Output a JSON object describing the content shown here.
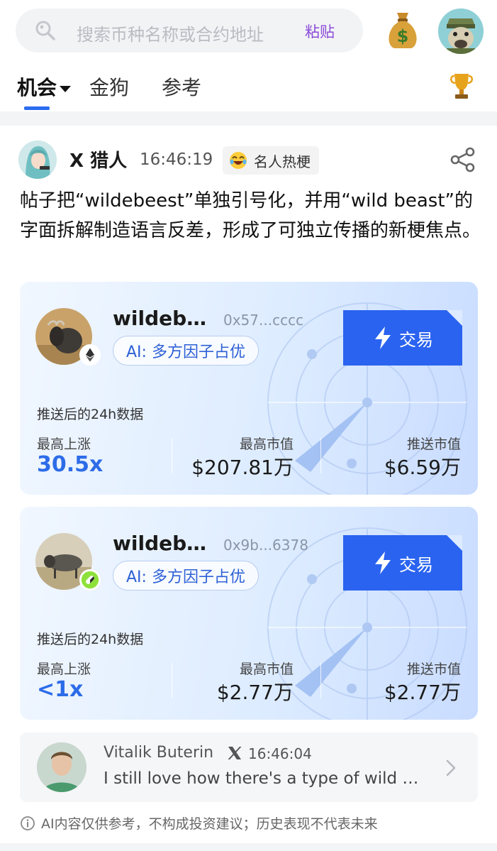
{
  "search": {
    "placeholder": "搜索币种名称或合约地址",
    "paste_label": "粘贴"
  },
  "tabs": [
    {
      "label": "机会"
    },
    {
      "label": "金狗"
    },
    {
      "label": "参考"
    }
  ],
  "post": {
    "author": "X 猎人",
    "time": "16:46:19",
    "tag": "名人热梗",
    "body": "帖子把“wildebeest”单独引号化，并用“wild beast”的字面拆解制造语言反差，形成了可独立传播的新梗焦点。"
  },
  "cards": [
    {
      "token_name": "wildeb…",
      "address": "0x57...cccc",
      "ai_label": "AI: 多方因子占优",
      "trade_label": "交易",
      "data_caption": "推送后的24h数据",
      "gain_label": "最高上涨",
      "gain_value": "30.5x",
      "max_mcap_label": "最高市值",
      "max_mcap_value": "$207.81万",
      "push_mcap_label": "推送市值",
      "push_mcap_value": "$6.59万",
      "chain_icon": "ethereum-icon"
    },
    {
      "token_name": "wildeb…",
      "address": "0x9b...6378",
      "ai_label": "AI: 多方因子占优",
      "trade_label": "交易",
      "data_caption": "推送后的24h数据",
      "gain_label": "最高上涨",
      "gain_value": "<1x",
      "max_mcap_label": "最高市值",
      "max_mcap_value": "$2.77万",
      "push_mcap_label": "推送市值",
      "push_mcap_value": "$2.77万",
      "chain_icon": "pump-icon"
    }
  ],
  "quote": {
    "name": "Vitalik Buterin",
    "time": "16:46:04",
    "text": "I still love how there's a type of wild …"
  },
  "disclaimer": "AI内容仅供参考，不构成投资建议；历史表现不代表未来",
  "colors": {
    "accent": "#2a63f0",
    "paste": "#8a4ad8",
    "gain": "#2d6ce8"
  }
}
